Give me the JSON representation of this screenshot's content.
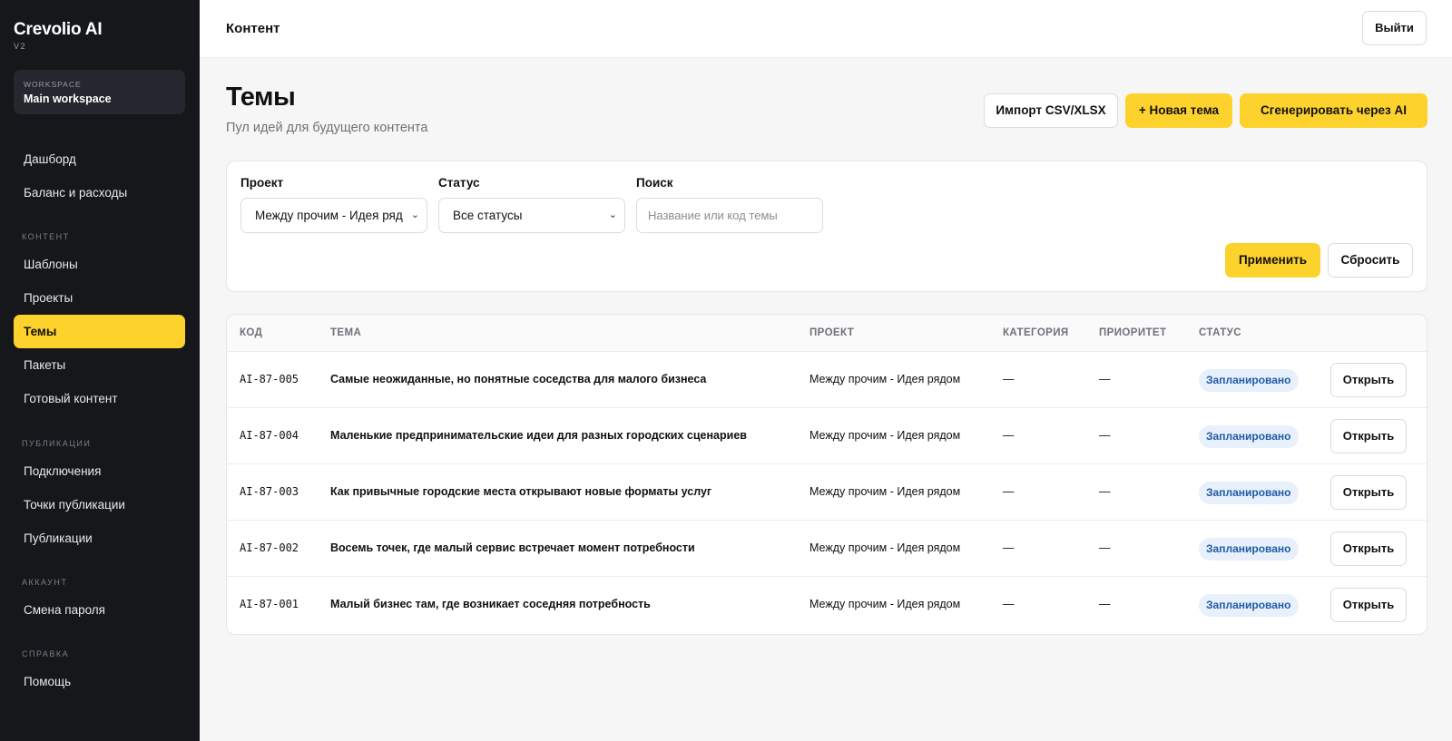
{
  "app": {
    "name": "Crevolio AI",
    "version": "V2"
  },
  "workspace": {
    "label": "WORKSPACE",
    "name": "Main workspace"
  },
  "sidebar": {
    "items_top": [
      {
        "label": "Дашборд"
      },
      {
        "label": "Баланс и расходы"
      }
    ],
    "sections": [
      {
        "title": "КОНТЕНТ",
        "items": [
          "Шаблоны",
          "Проекты",
          "Темы",
          "Пакеты",
          "Готовый контент"
        ]
      },
      {
        "title": "ПУБЛИКАЦИИ",
        "items": [
          "Подключения",
          "Точки публикации",
          "Публикации"
        ]
      },
      {
        "title": "АККАУНТ",
        "items": [
          "Смена пароля"
        ]
      },
      {
        "title": "СПРАВКА",
        "items": [
          "Помощь"
        ]
      }
    ],
    "active_item": "Темы"
  },
  "topbar": {
    "title": "Контент",
    "logout_label": "Выйти"
  },
  "page": {
    "title": "Темы",
    "subtitle": "Пул идей для будущего контента",
    "import_label": "Импорт CSV/XLSX",
    "new_label": "+ Новая тема",
    "generate_label": "Сгенерировать через AI"
  },
  "filters": {
    "project_label": "Проект",
    "project_value": "Между прочим - Идея ряд",
    "status_label": "Статус",
    "status_value": "Все статусы",
    "search_label": "Поиск",
    "search_placeholder": "Название или код темы",
    "apply_label": "Применить",
    "reset_label": "Сбросить"
  },
  "table": {
    "headers": {
      "code": "КОД",
      "topic": "ТЕМА",
      "project": "ПРОЕКТ",
      "category": "КАТЕГОРИЯ",
      "priority": "ПРИОРИТЕТ",
      "status": "СТАТУС"
    },
    "open_label": "Открыть",
    "rows": [
      {
        "code": "AI-87-005",
        "topic": "Самые неожиданные, но понятные соседства для малого бизнеса",
        "project": "Между прочим - Идея рядом",
        "category": "—",
        "priority": "—",
        "status": "Запланировано"
      },
      {
        "code": "AI-87-004",
        "topic": "Маленькие предпринимательские идеи для разных городских сценариев",
        "project": "Между прочим - Идея рядом",
        "category": "—",
        "priority": "—",
        "status": "Запланировано"
      },
      {
        "code": "AI-87-003",
        "topic": "Как привычные городские места открывают новые форматы услуг",
        "project": "Между прочим - Идея рядом",
        "category": "—",
        "priority": "—",
        "status": "Запланировано"
      },
      {
        "code": "AI-87-002",
        "topic": "Восемь точек, где малый сервис встречает момент потребности",
        "project": "Между прочим - Идея рядом",
        "category": "—",
        "priority": "—",
        "status": "Запланировано"
      },
      {
        "code": "AI-87-001",
        "topic": "Малый бизнес там, где возникает соседняя потребность",
        "project": "Между прочим - Идея рядом",
        "category": "—",
        "priority": "—",
        "status": "Запланировано"
      }
    ]
  },
  "colors": {
    "accent": "#fdd22d",
    "sidebar_bg": "#15171b",
    "badge_bg": "#e8f0fb",
    "badge_text": "#1f5ba8"
  }
}
